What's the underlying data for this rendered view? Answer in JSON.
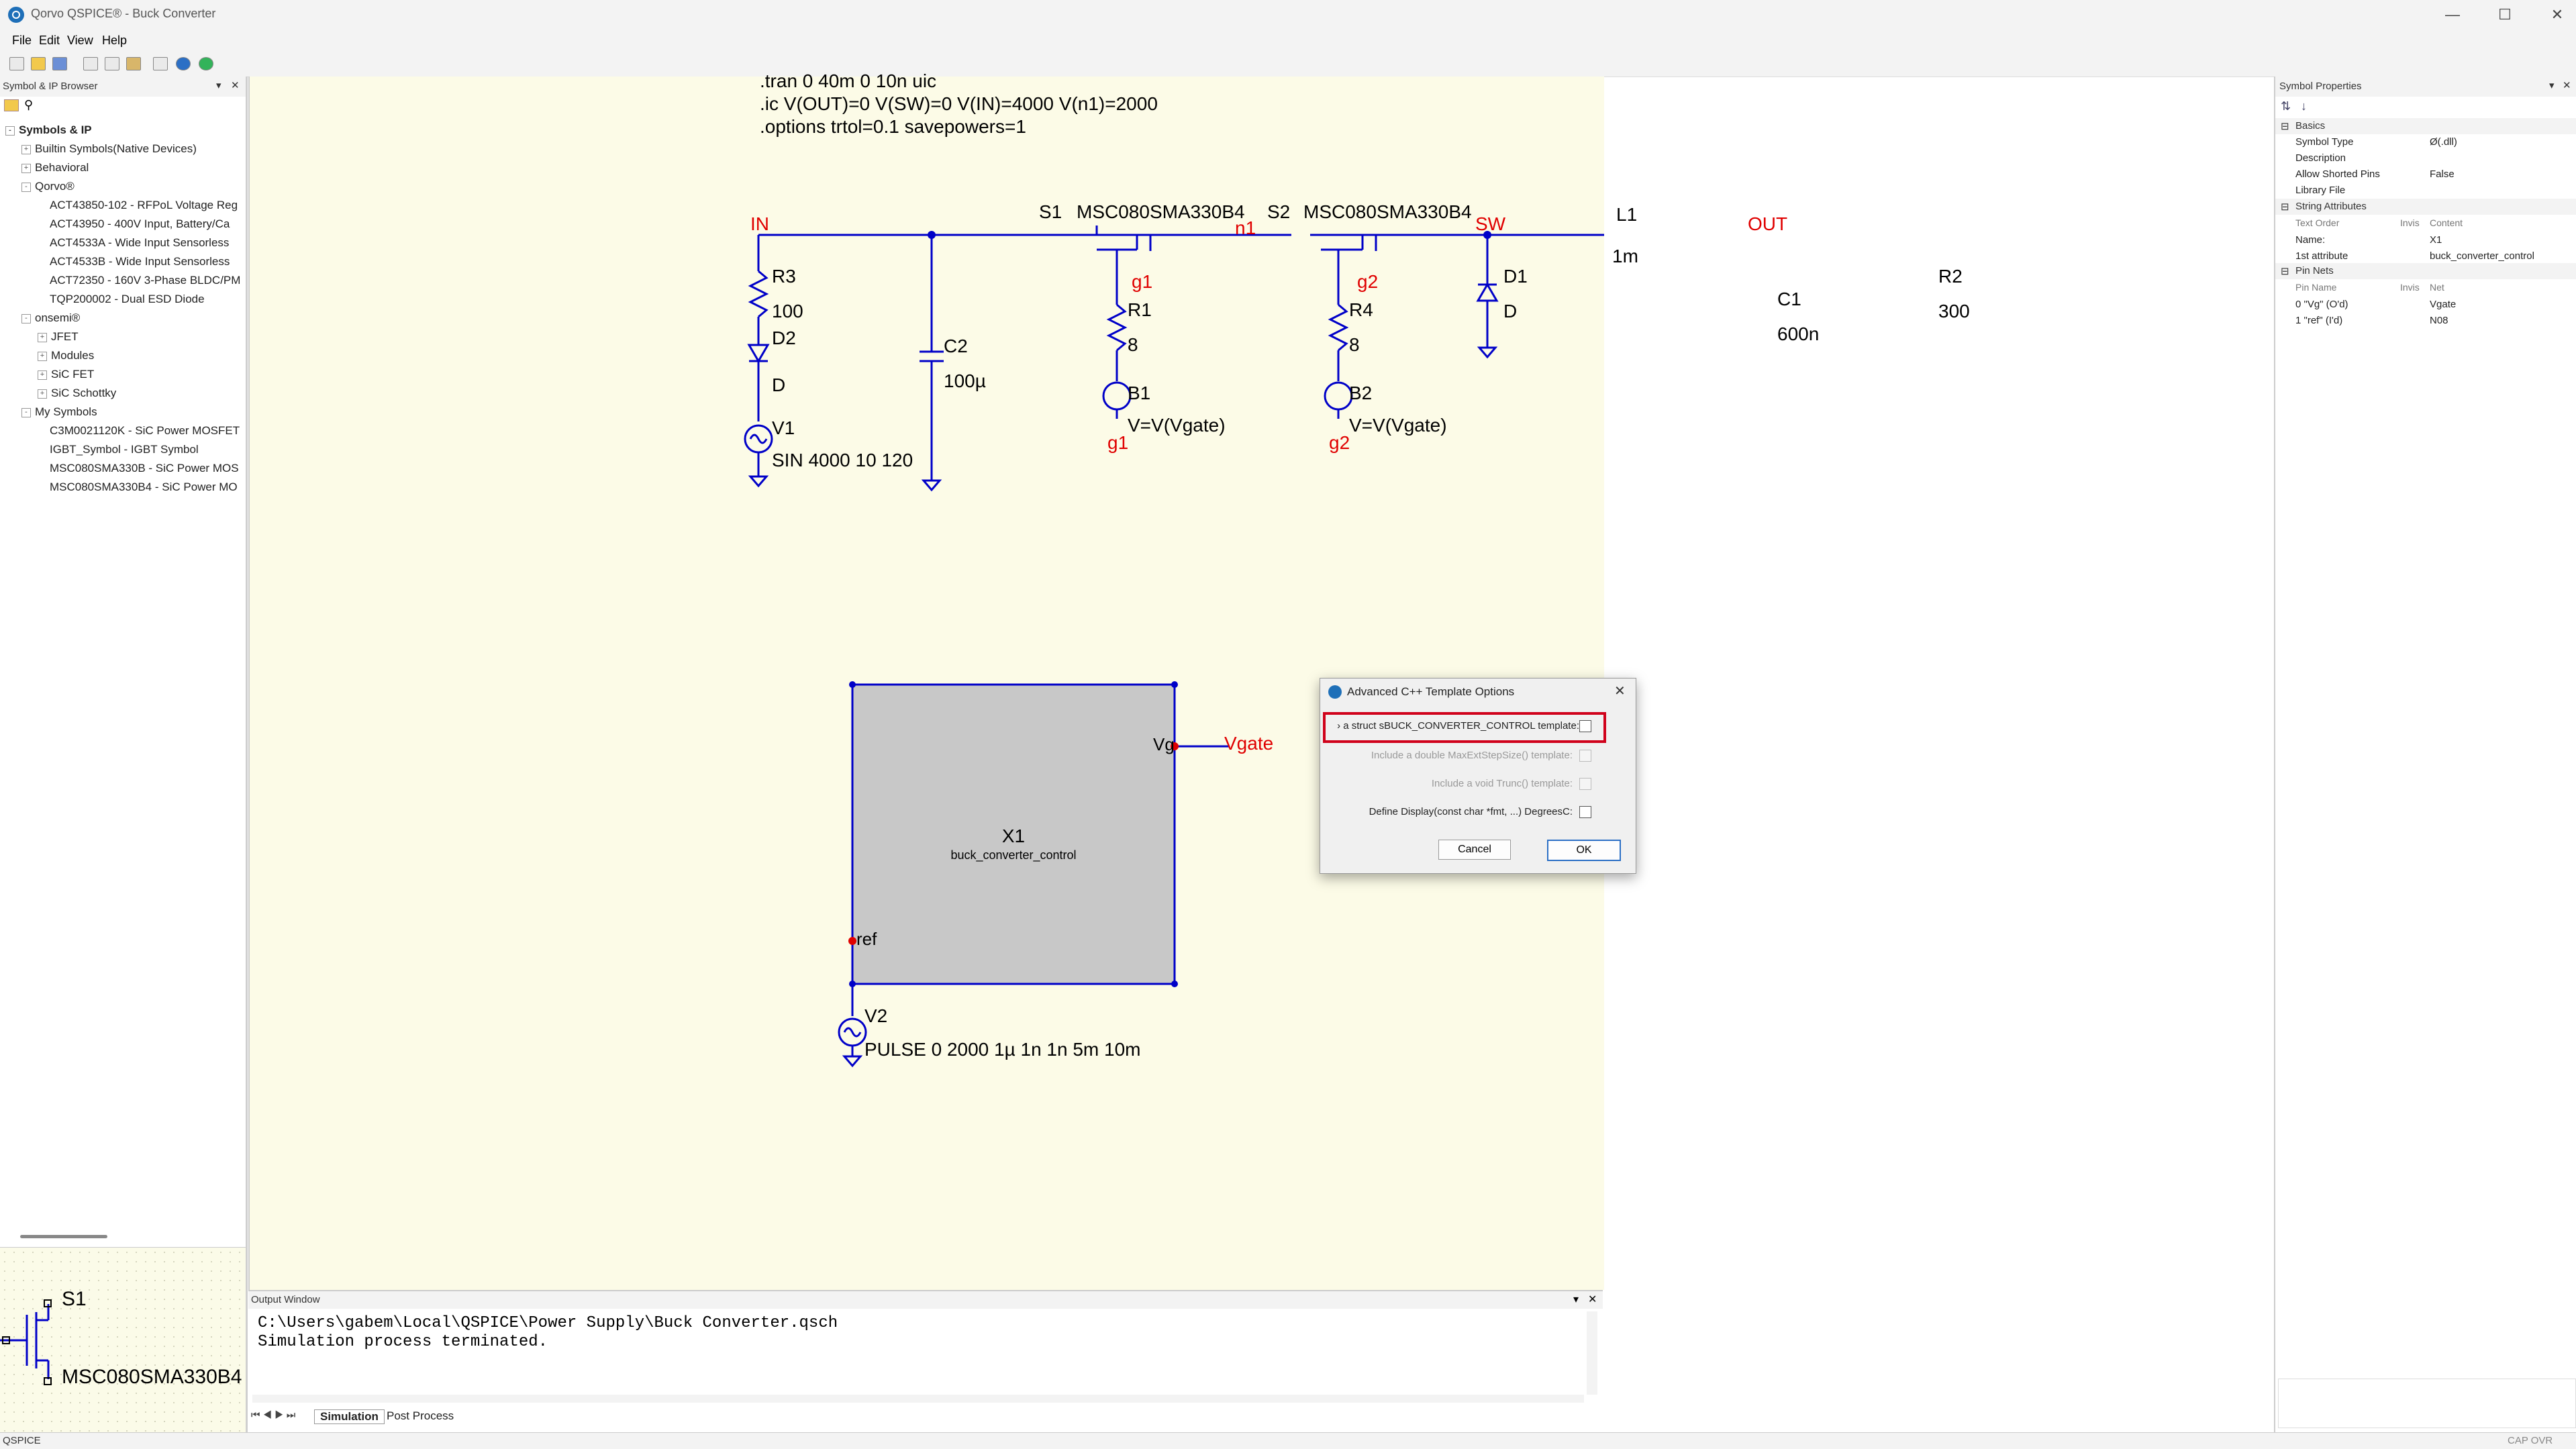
{
  "window": {
    "title": "Qorvo QSPICE® - Buck Converter",
    "minimize": "—",
    "maximize": "☐",
    "close": "✕"
  },
  "menu": [
    "File",
    "Edit",
    "View",
    "Help"
  ],
  "left_pane": {
    "title": "Symbol & IP Browser",
    "root": "Symbols & IP",
    "tree": [
      {
        "label": "Builtin Symbols(Native Devices)",
        "level": 1,
        "exp": "+"
      },
      {
        "label": "Behavioral",
        "level": 1,
        "exp": "+"
      },
      {
        "label": "Qorvo®",
        "level": 1,
        "exp": "-"
      },
      {
        "label": "ACT43850-102 - RFPoL Voltage Reg",
        "level": 2,
        "exp": ""
      },
      {
        "label": "ACT43950 - 400V Input, Battery/Ca",
        "level": 2,
        "exp": ""
      },
      {
        "label": "ACT4533A - Wide Input Sensorless",
        "level": 2,
        "exp": ""
      },
      {
        "label": "ACT4533B - Wide Input Sensorless",
        "level": 2,
        "exp": ""
      },
      {
        "label": "ACT72350 - 160V 3-Phase BLDC/PM",
        "level": 2,
        "exp": ""
      },
      {
        "label": "TQP200002 - Dual ESD Diode",
        "level": 2,
        "exp": ""
      },
      {
        "label": "onsemi®",
        "level": 1,
        "exp": "-"
      },
      {
        "label": "JFET",
        "level": 2,
        "exp": "+"
      },
      {
        "label": "Modules",
        "level": 2,
        "exp": "+"
      },
      {
        "label": "SiC FET",
        "level": 2,
        "exp": "+"
      },
      {
        "label": "SiC Schottky",
        "level": 2,
        "exp": "+"
      },
      {
        "label": "My Symbols",
        "level": 1,
        "exp": "-"
      },
      {
        "label": "C3M0021120K - SiC Power MOSFET",
        "level": 2,
        "exp": ""
      },
      {
        "label": "IGBT_Symbol - IGBT Symbol",
        "level": 2,
        "exp": ""
      },
      {
        "label": "MSC080SMA330B - SiC Power MOS",
        "level": 2,
        "exp": ""
      },
      {
        "label": "MSC080SMA330B4 - SiC Power MO",
        "level": 2,
        "exp": ""
      }
    ],
    "preview": {
      "name": "S1",
      "part": "MSC080SMA330B4"
    }
  },
  "schematic": {
    "directives": [
      ".tran 0 40m 0 10n uic",
      ".ic V(OUT)=0 V(SW)=0 V(IN)=4000 V(n1)=2000",
      ".options trtol=0.1 savepowers=1"
    ],
    "nets": {
      "in": "IN",
      "n1": "n1",
      "sw": "SW",
      "out": "OUT",
      "g1": "g1",
      "g2": "g2",
      "vgate": "Vgate"
    },
    "components": {
      "s1_name": "S1",
      "s1_part": "MSC080SMA330B4",
      "s2_name": "S2",
      "s2_part": "MSC080SMA330B4",
      "r3_name": "R3",
      "r3_value": "100",
      "d2_name": "D2",
      "d2_value": "D",
      "v1_name": "V1",
      "v1_value": "SIN 4000 10 120",
      "c2_name": "C2",
      "c2_value": "100µ",
      "r1_name": "R1",
      "r1_value": "8",
      "b1_name": "B1",
      "b1_value": "V=V(Vgate)",
      "r4_name": "R4",
      "r4_value": "8",
      "b2_name": "B2",
      "b2_value": "V=V(Vgate)",
      "d1_name": "D1",
      "d1_value": "D",
      "l1_name": "L1",
      "l1_value": "1m",
      "c1_name": "C1",
      "c1_value": "600n",
      "r2_name": "R2",
      "r2_value": "300",
      "x1_name": "X1",
      "x1_value": "buck_converter_control",
      "x1_pin_vg": "Vg",
      "x1_pin_ref": "ref",
      "v2_name": "V2",
      "v2_value": "PULSE 0 2000 1µ 1n 1n 5m 10m"
    }
  },
  "dialog": {
    "title": "Advanced C++ Template Options",
    "options": [
      {
        "label": "› a struct sBUCK_CONVERTER_CONTROL template:",
        "enabled": true
      },
      {
        "label": "Include a double MaxExtStepSize() template:",
        "enabled": false
      },
      {
        "label": "Include a void Trunc() template:",
        "enabled": false
      },
      {
        "label": "Define Display(const char *fmt, ...)  DegreesC:",
        "enabled": true
      }
    ],
    "cancel": "Cancel",
    "ok": "OK"
  },
  "right_pane": {
    "title": "Symbol Properties",
    "basics_header": "Basics",
    "basics": [
      {
        "name": "Symbol Type",
        "value": "Ø(.dll)"
      },
      {
        "name": "Description",
        "value": ""
      },
      {
        "name": "Allow Shorted Pins",
        "value": "False"
      },
      {
        "name": "Library File",
        "value": ""
      }
    ],
    "string_header": "String Attributes",
    "string_cols": [
      "Text Order",
      "Invis",
      "Content"
    ],
    "strings": [
      {
        "name": "Name:",
        "value": "X1"
      },
      {
        "name": "1st attribute",
        "value": "buck_converter_control"
      }
    ],
    "pin_header": "Pin Nets",
    "pin_cols": [
      "Pin Name",
      "Invis",
      "Net"
    ],
    "pins": [
      {
        "name": "0 \"Vg\" (O'd)",
        "value": "Vgate"
      },
      {
        "name": "1 \"ref\" (I'd)",
        "value": "N08"
      }
    ]
  },
  "output": {
    "title": "Output Window",
    "lines": [
      "C:\\Users\\gabem\\Local\\QSPICE\\Power Supply\\Buck Converter.qsch",
      "Simulation process terminated."
    ],
    "tabs": [
      "Simulation",
      "Post Process"
    ]
  },
  "status": {
    "left": "QSPICE",
    "right": "CAP OVR"
  },
  "colors": {
    "wire": "#0000c8",
    "net_label": "#e00000",
    "highlight": "#e00000"
  }
}
